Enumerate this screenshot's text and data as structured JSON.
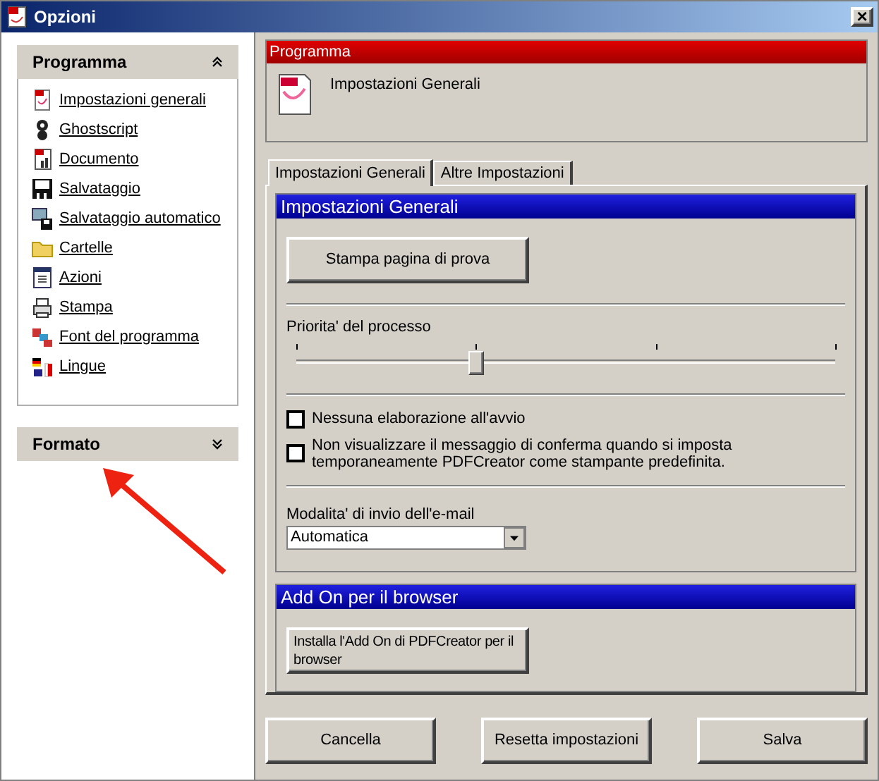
{
  "window": {
    "title": "Opzioni",
    "close": "×"
  },
  "sidebar": {
    "sections": [
      {
        "title": "Programma",
        "expanded": true,
        "items": [
          {
            "label": "Impostazioni generali"
          },
          {
            "label": "Ghostscript"
          },
          {
            "label": "Documento"
          },
          {
            "label": "Salvataggio"
          },
          {
            "label": "Salvataggio automatico"
          },
          {
            "label": "Cartelle"
          },
          {
            "label": "Azioni"
          },
          {
            "label": "Stampa"
          },
          {
            "label": "Font del programma"
          },
          {
            "label": "Lingue"
          }
        ]
      },
      {
        "title": "Formato",
        "expanded": false
      }
    ]
  },
  "header": {
    "caption": "Programma",
    "title": "Impostazioni Generali"
  },
  "tabs": [
    {
      "label": "Impostazioni Generali",
      "selected": true
    },
    {
      "label": "Altre Impostazioni",
      "selected": false
    }
  ],
  "general": {
    "title": "Impostazioni Generali",
    "test_button": "Stampa pagina di prova",
    "priority": {
      "label": "Priorita' del processo",
      "level": 0.333
    },
    "options": [
      {
        "label": "Nessuna elaborazione all'avvio",
        "checked": false
      },
      {
        "label": "Non visualizzare il messaggio di conferma quando si imposta temporaneamente PDFCreator come stampante predefinita.",
        "checked": false
      }
    ],
    "email": {
      "label": "Modalita' di invio dell'e-mail",
      "value": "Automatica"
    }
  },
  "addon": {
    "title": "Add On per il browser",
    "button": "Installa l'Add On di PDFCreator per il browser"
  },
  "buttons": [
    "Cancella",
    "Resetta impostazioni",
    "Salva"
  ]
}
